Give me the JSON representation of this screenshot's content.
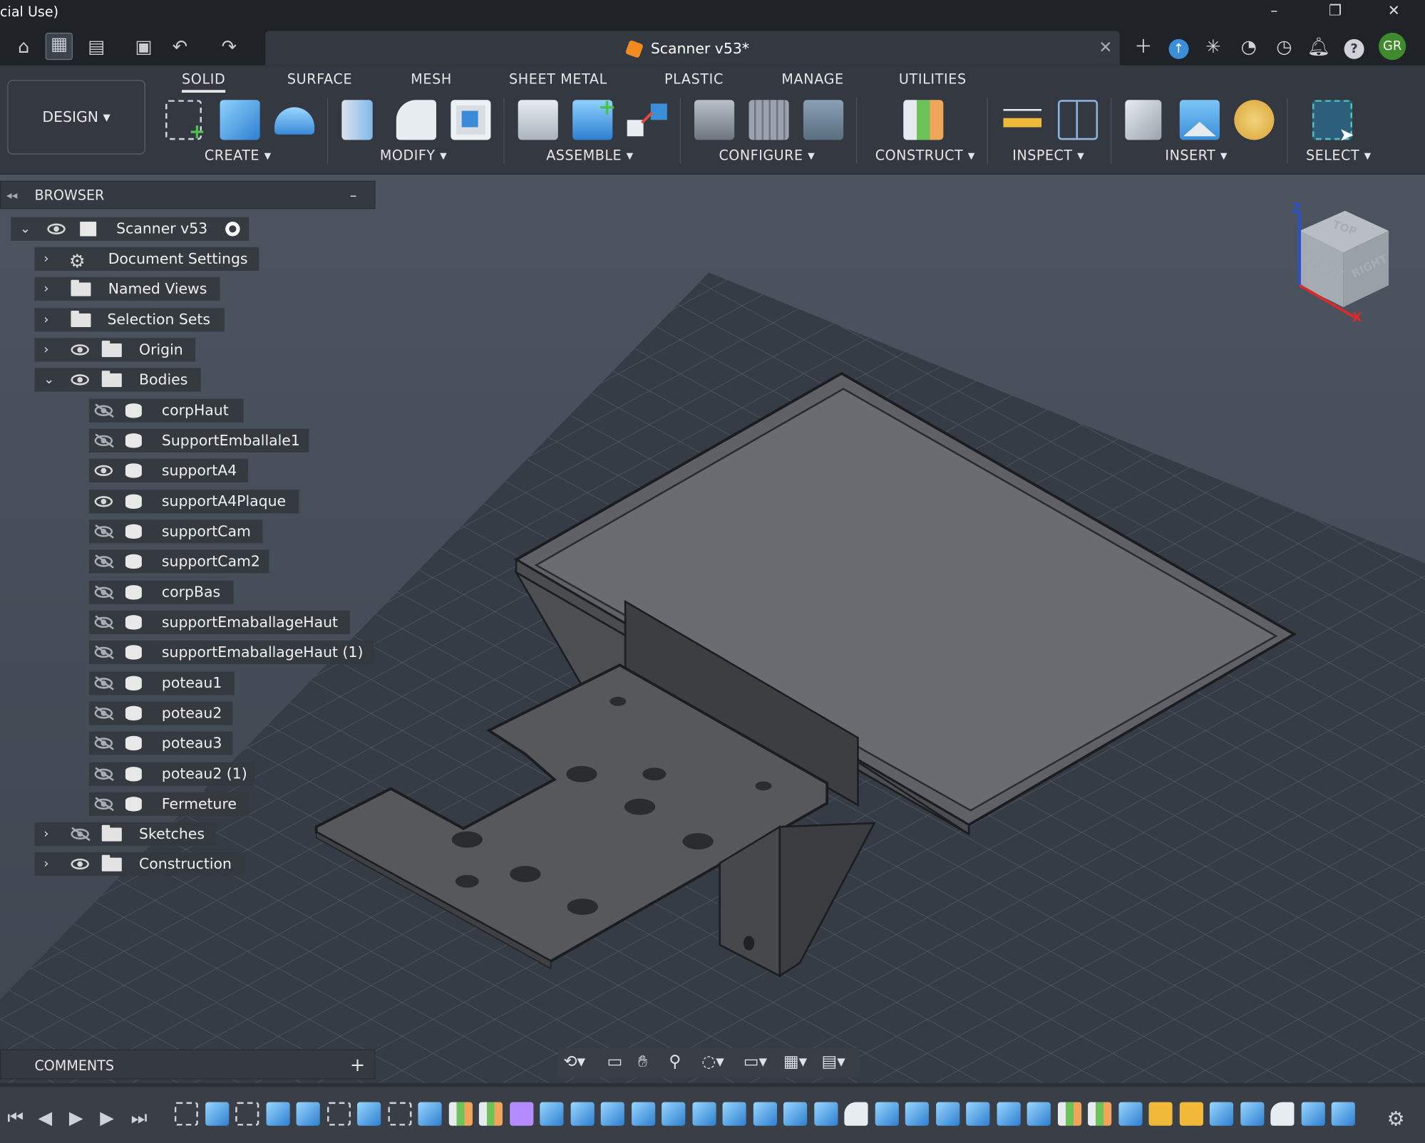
{
  "window": {
    "title_fragment": "cial Use)",
    "controls": {
      "minimize": "–",
      "restore": "❐",
      "close": "✕"
    }
  },
  "document_tab": {
    "name": "Scanner v53*",
    "close": "✕"
  },
  "user": {
    "initials": "GR"
  },
  "workspace": {
    "label": "DESIGN ▾"
  },
  "ribbon": {
    "tabs": [
      "SOLID",
      "SURFACE",
      "MESH",
      "SHEET METAL",
      "PLASTIC",
      "MANAGE",
      "UTILITIES"
    ],
    "groups": [
      "CREATE ▾",
      "MODIFY ▾",
      "ASSEMBLE ▾",
      "CONFIGURE ▾",
      "CONSTRUCT ▾",
      "INSPECT ▾",
      "INSERT ▾",
      "SELECT ▾"
    ]
  },
  "browser": {
    "title": "BROWSER",
    "collapse": "–",
    "root": "Scanner v53",
    "items": [
      "Document Settings",
      "Named Views",
      "Selection Sets",
      "Origin",
      "Bodies",
      "corpHaut",
      "SupportEmballale1",
      "supportA4",
      "supportA4Plaque",
      "supportCam",
      "supportCam2",
      "corpBas",
      "supportEmaballageHaut",
      "supportEmaballageHaut (1)",
      "poteau1",
      "poteau2",
      "poteau3",
      "poteau2 (1)",
      "Fermeture",
      "Sketches",
      "Construction"
    ]
  },
  "comments": {
    "title": "COMMENTS",
    "add": "+"
  },
  "viewcube": {
    "top": "TOP",
    "front": "FRONT",
    "right": "RIGHT",
    "z": "Z",
    "x": "X"
  },
  "colors": {
    "accent": "#3b8fd9",
    "avatar": "#3e8a2c",
    "doc_icon": "#f28a22"
  }
}
